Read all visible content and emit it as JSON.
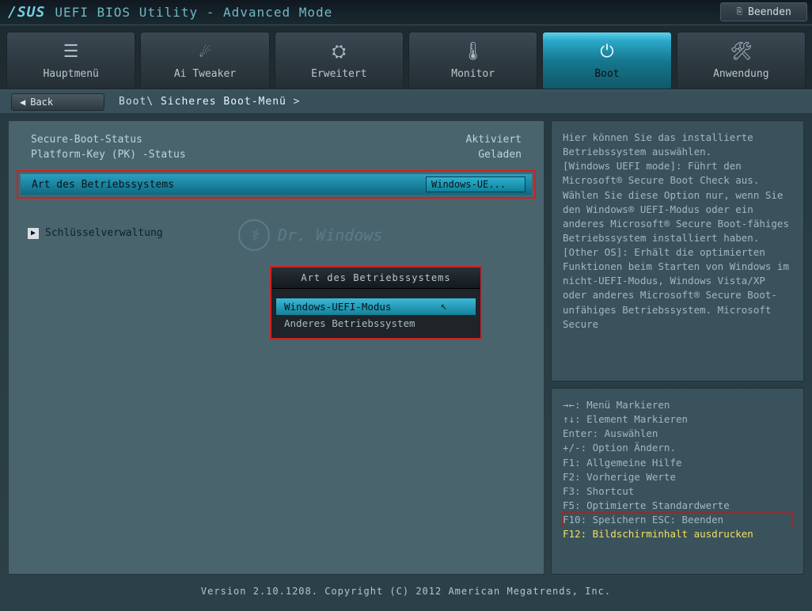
{
  "header": {
    "logo": "/SUS",
    "title": "UEFI BIOS Utility - Advanced Mode",
    "exit_label": "Beenden"
  },
  "tabs": [
    {
      "label": "Hauptmenü",
      "icon_name": "list-icon"
    },
    {
      "label": "Ai Tweaker",
      "icon_name": "chip-icon"
    },
    {
      "label": "Erweitert",
      "icon_name": "gear-icon"
    },
    {
      "label": "Monitor",
      "icon_name": "thermometer-icon"
    },
    {
      "label": "Boot",
      "icon_name": "power-icon"
    },
    {
      "label": "Anwendung",
      "icon_name": "tool-icon"
    }
  ],
  "active_tab_index": 4,
  "breadcrumb": {
    "back_label": "Back",
    "path_root": "Boot",
    "path_current": "Sicheres Boot-Menü"
  },
  "settings": {
    "status": [
      {
        "label": "Secure-Boot-Status",
        "value": "Aktiviert"
      },
      {
        "label": "Platform-Key (PK) -Status",
        "value": "Geladen"
      }
    ],
    "os_type": {
      "label": "Art des Betriebssystems",
      "value": "Windows-UE..."
    },
    "submenu": "Schlüsselverwaltung"
  },
  "watermark": "Dr. Windows",
  "popup": {
    "title": "Art des Betriebssystems",
    "items": [
      "Windows-UEFI-Modus",
      "Anderes Betriebssystem"
    ],
    "selected_index": 0
  },
  "help_text": "Hier können Sie das installierte Betriebssystem auswählen.\n[Windows UEFI mode]: Führt den Microsoft® Secure Boot Check aus. Wählen Sie diese Option nur, wenn Sie den Windows® UEFI-Modus oder ein anderes Microsoft® Secure Boot-fähiges Betriebssystem installiert haben.\n[Other OS]: Erhält die optimierten Funktionen beim Starten von Windows im nicht-UEFI-Modus, Windows Vista/XP oder anderes Microsoft® Secure Boot-unfähiges Betriebssystem. Microsoft Secure",
  "keys": [
    "→←: Menü Markieren",
    "↑↓: Element Markieren",
    "Enter: Auswählen",
    "+/-: Option Ändern.",
    "F1: Allgemeine Hilfe",
    "F2: Vorherige Werte",
    "F3: Shortcut",
    "F5: Optimierte Standardwerte",
    "F10: Speichern  ESC: Beenden",
    "F12: Bildschirminhalt ausdrucken"
  ],
  "key_highlight_index": 8,
  "key_yellow_index": 9,
  "footer": "Version 2.10.1208. Copyright (C) 2012 American Megatrends, Inc."
}
